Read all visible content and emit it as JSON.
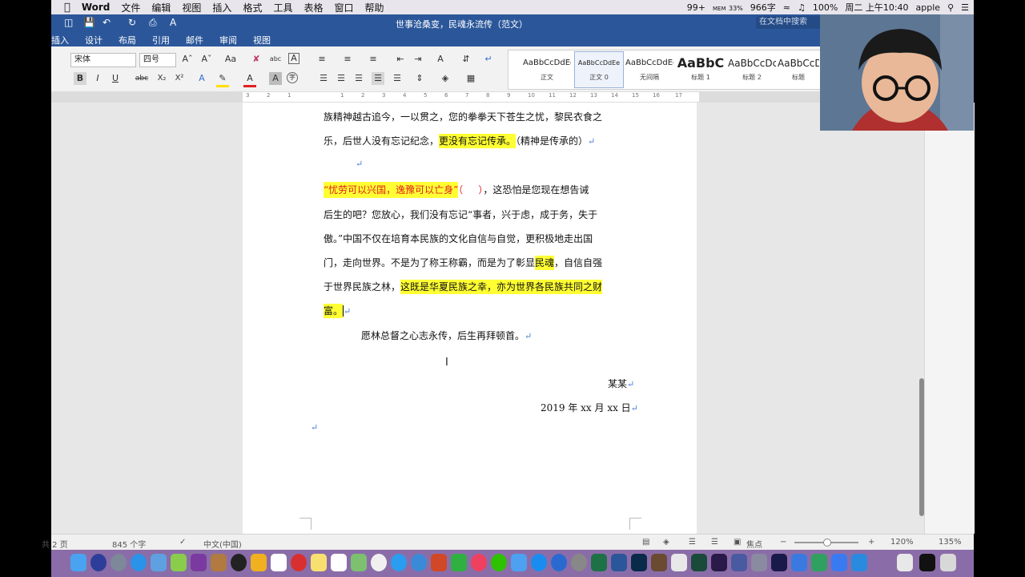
{
  "menubar": {
    "items": [
      "Word",
      "文件",
      "编辑",
      "视图",
      "插入",
      "格式",
      "工具",
      "表格",
      "窗口",
      "帮助"
    ],
    "status": {
      "notifications": "99+",
      "battery_mem": "33%",
      "mem_label": "MEM",
      "word_count_tray": "966字",
      "battery": "100%",
      "clock": "周二 上午10:40",
      "user": "apple"
    }
  },
  "titlebar": {
    "document_title": "世事沧桑变，民魂永流传（范文）",
    "search_placeholder": "在文档中搜索"
  },
  "tabs": [
    "插入",
    "设计",
    "布局",
    "引用",
    "邮件",
    "审阅",
    "视图"
  ],
  "ribbon": {
    "font_name": "宋体",
    "font_size": "四号",
    "styles": [
      {
        "preview": "AaBbCcDdEe",
        "name": "正文"
      },
      {
        "preview": "AaBbCcDdEe",
        "name": "正文 0"
      },
      {
        "preview": "AaBbCcDdEe",
        "name": "无间隔"
      },
      {
        "preview": "AaBbC",
        "name": "标题 1"
      },
      {
        "preview": "AaBbCcDc",
        "name": "标题 2"
      },
      {
        "preview": "AaBbCcD",
        "name": "标题"
      }
    ],
    "buttons": {
      "bold": "B",
      "italic": "I",
      "underline": "U",
      "strike": "abc",
      "sub": "X₂",
      "sup": "X²"
    }
  },
  "ruler": {
    "ticks": [
      "3",
      "2",
      "1",
      "1",
      "2",
      "3",
      "4",
      "5",
      "6",
      "7",
      "8",
      "9",
      "10",
      "11",
      "12",
      "13",
      "14",
      "15",
      "16",
      "17"
    ]
  },
  "document": {
    "l1": "族精神越古追今，一以贯之，您的拳拳天下苍生之忧，黎民衣食之",
    "l2a": "乐，后世人没有忘记纪念，",
    "l2b": "更没有忘记传承。",
    "l2c": "（精神是传承的）",
    "l4a": "“忧劳可以兴国，逸豫可以亡身”",
    "l4b": "（     ）",
    "l4c": "，这恐怕是您现在想告诫",
    "l5": "后生的吧？您放心，我们没有忘记“事者，兴于虑，成于务，失于",
    "l6": "傲。”中国不仅在培育本民族的文化自信与自觉，更积极地走出国",
    "l7a": "门，走向世界。不是为了称王称霸，而是为了彰显",
    "l7b": "民魂",
    "l7c": "，自信自强",
    "l8a": "于世界民族之林，",
    "l8b": "这既是华夏民族之幸，亦为世界各民族共同之财",
    "l9": "富。",
    "l10": "愿林总督之心志永传，后生再拜顿首。",
    "signer": "某某",
    "date": "2019 年 xx 月 xx 日",
    "para_mark": "↵"
  },
  "statusbar": {
    "pages": "共 2 页",
    "words": "845 个字",
    "language": "中文(中国)",
    "focus": "焦点",
    "zoom": "120%",
    "zoom_right": "135%"
  }
}
